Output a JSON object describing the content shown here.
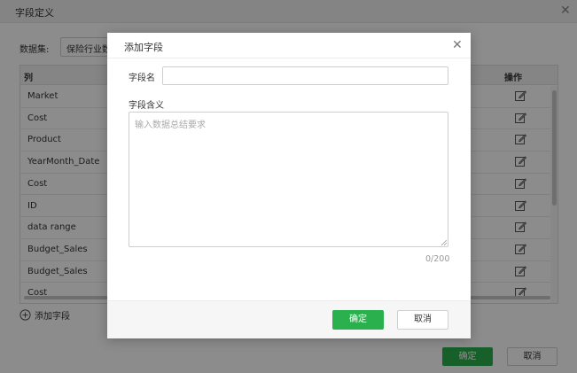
{
  "window": {
    "title": "字段定义",
    "dataset_label": "数据集:",
    "dataset_value": "保险行业数"
  },
  "table": {
    "col_header": "列",
    "op_header": "操作",
    "rows": [
      "Market",
      "Cost",
      "Product",
      "YearMonth_Date",
      "Cost",
      "ID",
      "data range",
      "Budget_Sales",
      "Budget_Sales",
      "Cost"
    ]
  },
  "add_field_label": "添加字段",
  "footer": {
    "ok_label": "确定",
    "cancel_label": "取消"
  },
  "modal": {
    "title": "添加字段",
    "name_label": "字段名",
    "name_value": "",
    "meaning_label": "字段含义",
    "meaning_placeholder": "输入数据总结要求",
    "counter": "0/200",
    "ok_label": "确定",
    "cancel_label": "取消"
  },
  "colors": {
    "accent": "#2bb04e",
    "overlay": "rgba(0,0,0,0.45)"
  },
  "icons": [
    "close-icon",
    "edit-icon",
    "plus-circle-icon",
    "resize-grip-icon"
  ]
}
